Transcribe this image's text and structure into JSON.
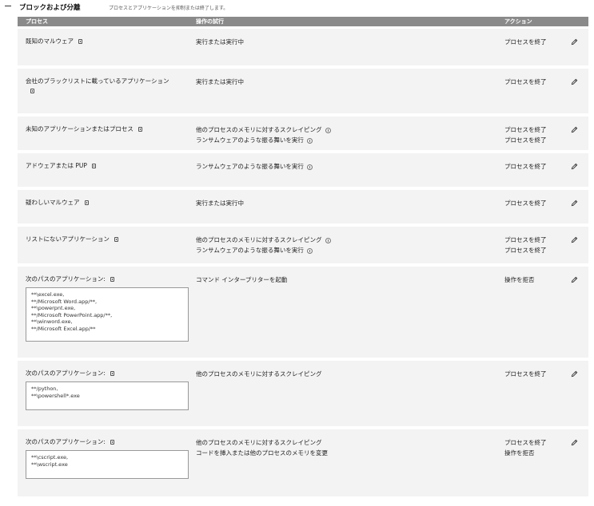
{
  "section": {
    "title": "ブロックおよび分離",
    "description": "プロセスとアプリケーションを抑制または終了します。"
  },
  "columns": {
    "process": "プロセス",
    "operation": "操作の試行",
    "action": "アクション"
  },
  "rows": [
    {
      "process": "既知のマルウェア",
      "operations": [
        "実行または実行中"
      ],
      "actions": [
        "プロセスを終了"
      ]
    },
    {
      "process": "会社のブラックリストに載っているアプリケーション",
      "operations": [
        "実行または実行中"
      ],
      "actions": [
        "プロセスを終了"
      ]
    },
    {
      "process": "未知のアプリケーションまたはプロセス",
      "operations": [
        "他のプロセスのメモリに対するスクレイピング",
        "ランサムウェアのような振る舞いを実行"
      ],
      "actions": [
        "プロセスを終了",
        "プロセスを終了"
      ]
    },
    {
      "process": "アドウェアまたは PUP",
      "operations": [
        "ランサムウェアのような振る舞いを実行"
      ],
      "actions": [
        "プロセスを終了"
      ]
    },
    {
      "process": "疑わしいマルウェア",
      "operations": [
        "実行または実行中"
      ],
      "actions": [
        "プロセスを終了"
      ]
    },
    {
      "process": "リストにないアプリケーション",
      "operations": [
        "他のプロセスのメモリに対するスクレイピング",
        "ランサムウェアのような振る舞いを実行"
      ],
      "actions": [
        "プロセスを終了",
        "プロセスを終了"
      ]
    },
    {
      "process": "次のパスのアプリケーション:",
      "paths": [
        "**\\excel.exe,",
        "**/Microsoft Word.app/**,",
        "**\\powerpnt.exe,",
        "**/Microsoft PowerPoint.app/**,",
        "**\\winword.exe,",
        "**/Microsoft Excel.app/**"
      ],
      "operations": [
        "コマンド インタープリターを起動"
      ],
      "actions": [
        "操作を拒否"
      ]
    },
    {
      "process": "次のパスのアプリケーション:",
      "paths": [
        "**/python,",
        "**\\powershell*.exe"
      ],
      "operations": [
        "他のプロセスのメモリに対するスクレイピング"
      ],
      "actions": [
        "プロセスを終了"
      ]
    },
    {
      "process": "次のパスのアプリケーション:",
      "paths": [
        "**\\cscript.exe,",
        "**\\wscript.exe"
      ],
      "operations": [
        "他のプロセスのメモリに対するスクレイピング",
        "コードを挿入または他のプロセスのメモリを変更"
      ],
      "actions": [
        "プロセスを終了",
        "操作を拒否"
      ]
    }
  ],
  "icons": {
    "collapse": "minus-icon",
    "copy": "copy-icon",
    "info": "info-icon",
    "edit": "pencil-icon"
  }
}
